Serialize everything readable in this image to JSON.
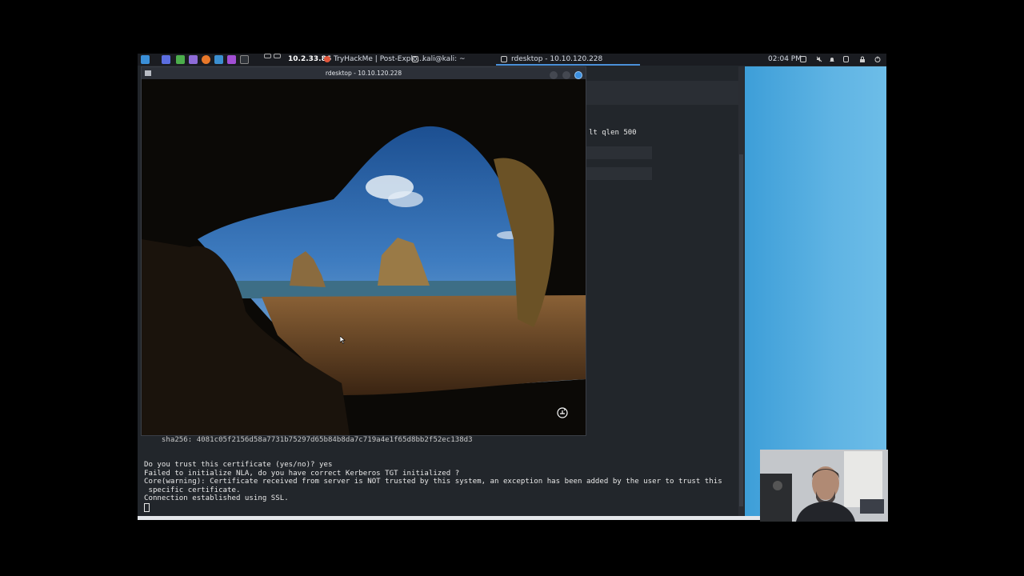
{
  "taskbar": {
    "ip": "10.2.33.86",
    "tasks": [
      "TryHackMe | Post-Explo...",
      "kali@kali: ~",
      "rdesktop - 10.10.120.228"
    ],
    "time": "02:04 PM"
  },
  "rdesktop": {
    "title": "rdesktop - 10.10.120.228"
  },
  "terminal": {
    "right_fragment": "lt qlen 500",
    "lines": [
      "    sha256: 4081c05f2156d58a7731b75297d65b84b8da7c719a4e1f65d8bb2f52ec138d3",
      "",
      "Do you trust this certificate (yes/no)? yes",
      "Failed to initialize NLA, do you have correct Kerberos TGT initialized ?",
      "Core(warning): Certificate received from server is NOT trusted by this system, an exception has been added by the user to trust this",
      " specific certificate.",
      "Connection established using SSL."
    ]
  },
  "colors": {
    "desktop_blue": "#4aa8de",
    "terminal_bg": "#22262b",
    "panel_bg": "#1a1c21"
  }
}
